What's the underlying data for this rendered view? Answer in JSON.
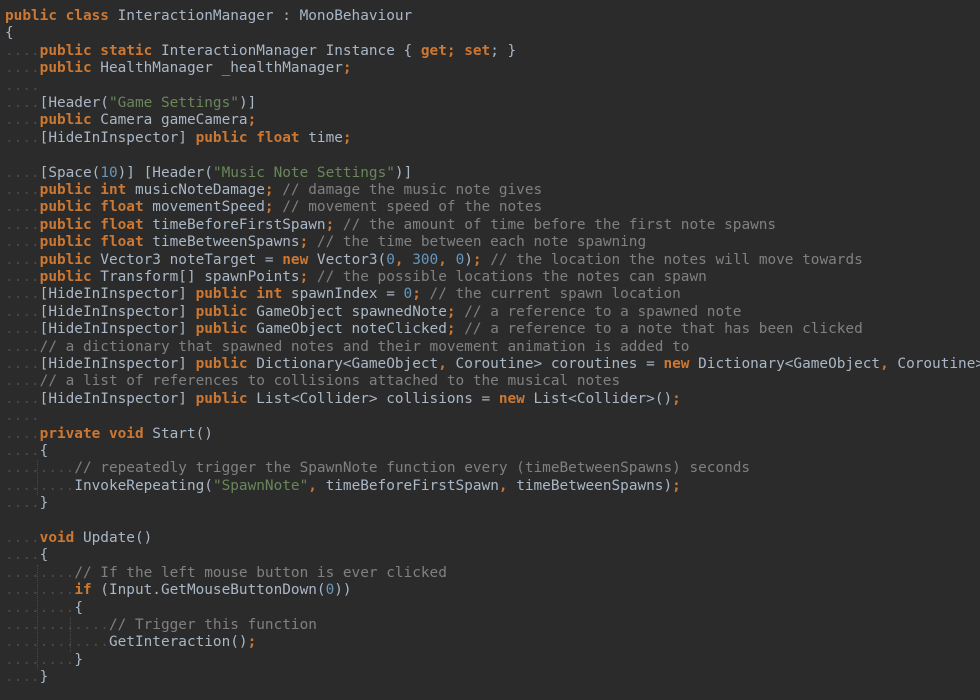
{
  "colors": {
    "background": "#2b2b2b",
    "plain": "#a9b7c6",
    "keyword": "#cc7832",
    "comment": "#808080",
    "string": "#6a8759",
    "number": "#6897bb",
    "indent_dots": "#4a4a4a"
  },
  "editor": {
    "lines": [
      {
        "indent": 0,
        "tokens": [
          {
            "t": "public class",
            "c": "kw"
          },
          {
            "t": " InteractionManager : MonoBehaviour",
            "c": "pl"
          }
        ]
      },
      {
        "indent": 0,
        "tokens": [
          {
            "t": "{",
            "c": "pl"
          }
        ]
      },
      {
        "indent": 4,
        "tokens": [
          {
            "t": "public static",
            "c": "kw"
          },
          {
            "t": " InteractionManager Instance { ",
            "c": "pl"
          },
          {
            "t": "get",
            "c": "kw"
          },
          {
            "t": "; ",
            "c": "kw"
          },
          {
            "t": "set",
            "c": "kw"
          },
          {
            "t": "; }",
            "c": "pl"
          }
        ]
      },
      {
        "indent": 4,
        "tokens": [
          {
            "t": "public",
            "c": "kw"
          },
          {
            "t": " HealthManager _healthManager",
            "c": "pl"
          },
          {
            "t": ";",
            "c": "kw"
          }
        ]
      },
      {
        "indent": 4,
        "tokens": []
      },
      {
        "indent": 4,
        "tokens": [
          {
            "t": "[Header(",
            "c": "pl"
          },
          {
            "t": "\"Game Settings\"",
            "c": "str"
          },
          {
            "t": ")]",
            "c": "pl"
          }
        ]
      },
      {
        "indent": 4,
        "tokens": [
          {
            "t": "public",
            "c": "kw"
          },
          {
            "t": " Camera gameCamera",
            "c": "pl"
          },
          {
            "t": ";",
            "c": "kw"
          }
        ]
      },
      {
        "indent": 4,
        "tokens": [
          {
            "t": "[HideInInspector] ",
            "c": "pl"
          },
          {
            "t": "public float",
            "c": "kw"
          },
          {
            "t": " time",
            "c": "pl"
          },
          {
            "t": ";",
            "c": "kw"
          }
        ]
      },
      {
        "indent": 0,
        "tokens": []
      },
      {
        "indent": 4,
        "tokens": [
          {
            "t": "[Space(",
            "c": "pl"
          },
          {
            "t": "10",
            "c": "num"
          },
          {
            "t": ")] [Header(",
            "c": "pl"
          },
          {
            "t": "\"Music Note Settings\"",
            "c": "str"
          },
          {
            "t": ")]",
            "c": "pl"
          }
        ]
      },
      {
        "indent": 4,
        "tokens": [
          {
            "t": "public int",
            "c": "kw"
          },
          {
            "t": " musicNoteDamage",
            "c": "pl"
          },
          {
            "t": "; ",
            "c": "kw"
          },
          {
            "t": "// damage the music note gives",
            "c": "cm"
          }
        ]
      },
      {
        "indent": 4,
        "tokens": [
          {
            "t": "public float",
            "c": "kw"
          },
          {
            "t": " movementSpeed",
            "c": "pl"
          },
          {
            "t": "; ",
            "c": "kw"
          },
          {
            "t": "// movement speed of the notes",
            "c": "cm"
          }
        ]
      },
      {
        "indent": 4,
        "tokens": [
          {
            "t": "public float",
            "c": "kw"
          },
          {
            "t": " timeBeforeFirstSpawn",
            "c": "pl"
          },
          {
            "t": "; ",
            "c": "kw"
          },
          {
            "t": "// the amount of time before the first note spawns",
            "c": "cm"
          }
        ]
      },
      {
        "indent": 4,
        "tokens": [
          {
            "t": "public float",
            "c": "kw"
          },
          {
            "t": " timeBetweenSpawns",
            "c": "pl"
          },
          {
            "t": "; ",
            "c": "kw"
          },
          {
            "t": "// the time between each note spawning",
            "c": "cm"
          }
        ]
      },
      {
        "indent": 4,
        "tokens": [
          {
            "t": "public",
            "c": "kw"
          },
          {
            "t": " Vector3 noteTarget = ",
            "c": "pl"
          },
          {
            "t": "new",
            "c": "kw"
          },
          {
            "t": " Vector3(",
            "c": "pl"
          },
          {
            "t": "0",
            "c": "num"
          },
          {
            "t": ", ",
            "c": "kw"
          },
          {
            "t": "300",
            "c": "num"
          },
          {
            "t": ", ",
            "c": "kw"
          },
          {
            "t": "0",
            "c": "num"
          },
          {
            "t": ")",
            "c": "pl"
          },
          {
            "t": "; ",
            "c": "kw"
          },
          {
            "t": "// the location the notes will move towards",
            "c": "cm"
          }
        ]
      },
      {
        "indent": 4,
        "tokens": [
          {
            "t": "public",
            "c": "kw"
          },
          {
            "t": " Transform[] spawnPoints",
            "c": "pl"
          },
          {
            "t": "; ",
            "c": "kw"
          },
          {
            "t": "// the possible locations the notes can spawn",
            "c": "cm"
          }
        ]
      },
      {
        "indent": 4,
        "tokens": [
          {
            "t": "[HideInInspector] ",
            "c": "pl"
          },
          {
            "t": "public int",
            "c": "kw"
          },
          {
            "t": " spawnIndex = ",
            "c": "pl"
          },
          {
            "t": "0",
            "c": "num"
          },
          {
            "t": "; ",
            "c": "kw"
          },
          {
            "t": "// the current spawn location",
            "c": "cm"
          }
        ]
      },
      {
        "indent": 4,
        "tokens": [
          {
            "t": "[HideInInspector] ",
            "c": "pl"
          },
          {
            "t": "public",
            "c": "kw"
          },
          {
            "t": " GameObject spawnedNote",
            "c": "pl"
          },
          {
            "t": "; ",
            "c": "kw"
          },
          {
            "t": "// a reference to a spawned note",
            "c": "cm"
          }
        ]
      },
      {
        "indent": 4,
        "tokens": [
          {
            "t": "[HideInInspector] ",
            "c": "pl"
          },
          {
            "t": "public",
            "c": "kw"
          },
          {
            "t": " GameObject noteClicked",
            "c": "pl"
          },
          {
            "t": "; ",
            "c": "kw"
          },
          {
            "t": "// a reference to a note that has been clicked",
            "c": "cm"
          }
        ]
      },
      {
        "indent": 4,
        "tokens": [
          {
            "t": "// a dictionary that spawned notes and their movement animation is added to",
            "c": "cm"
          }
        ]
      },
      {
        "indent": 4,
        "tokens": [
          {
            "t": "[HideInInspector] ",
            "c": "pl"
          },
          {
            "t": "public",
            "c": "kw"
          },
          {
            "t": " Dictionary<GameObject",
            "c": "pl"
          },
          {
            "t": ", ",
            "c": "kw"
          },
          {
            "t": "Coroutine> coroutines = ",
            "c": "pl"
          },
          {
            "t": "new",
            "c": "kw"
          },
          {
            "t": " Dictionary<GameObject",
            "c": "pl"
          },
          {
            "t": ", ",
            "c": "kw"
          },
          {
            "t": "Coroutine>()",
            "c": "pl"
          },
          {
            "t": ";",
            "c": "kw"
          }
        ]
      },
      {
        "indent": 4,
        "tokens": [
          {
            "t": "// a list of references to collisions attached to the musical notes",
            "c": "cm"
          }
        ]
      },
      {
        "indent": 4,
        "tokens": [
          {
            "t": "[HideInInspector] ",
            "c": "pl"
          },
          {
            "t": "public",
            "c": "kw"
          },
          {
            "t": " List<Collider> collisions = ",
            "c": "pl"
          },
          {
            "t": "new",
            "c": "kw"
          },
          {
            "t": " List<Collider>()",
            "c": "pl"
          },
          {
            "t": ";",
            "c": "kw"
          }
        ]
      },
      {
        "indent": 4,
        "tokens": []
      },
      {
        "indent": 4,
        "tokens": [
          {
            "t": "private void",
            "c": "kw"
          },
          {
            "t": " Start()",
            "c": "pl"
          }
        ]
      },
      {
        "indent": 4,
        "tokens": [
          {
            "t": "{",
            "c": "pl"
          }
        ]
      },
      {
        "indent": 8,
        "tokens": [
          {
            "t": "// repeatedly trigger the SpawnNote function every (timeBetweenSpawns) seconds",
            "c": "cm"
          }
        ]
      },
      {
        "indent": 8,
        "tokens": [
          {
            "t": "InvokeRepeating(",
            "c": "pl"
          },
          {
            "t": "\"SpawnNote\"",
            "c": "str"
          },
          {
            "t": ", ",
            "c": "kw"
          },
          {
            "t": "timeBeforeFirstSpawn",
            "c": "pl"
          },
          {
            "t": ", ",
            "c": "kw"
          },
          {
            "t": "timeBetweenSpawns)",
            "c": "pl"
          },
          {
            "t": ";",
            "c": "kw"
          }
        ]
      },
      {
        "indent": 4,
        "tokens": [
          {
            "t": "}",
            "c": "pl"
          }
        ]
      },
      {
        "indent": 0,
        "tokens": []
      },
      {
        "indent": 4,
        "tokens": [
          {
            "t": "void",
            "c": "kw"
          },
          {
            "t": " Update()",
            "c": "pl"
          }
        ]
      },
      {
        "indent": 4,
        "tokens": [
          {
            "t": "{",
            "c": "pl"
          }
        ]
      },
      {
        "indent": 8,
        "tokens": [
          {
            "t": "// If the left mouse button is ever clicked",
            "c": "cm"
          }
        ]
      },
      {
        "indent": 8,
        "tokens": [
          {
            "t": "if",
            "c": "kw"
          },
          {
            "t": " (Input.GetMouseButtonDown(",
            "c": "pl"
          },
          {
            "t": "0",
            "c": "num"
          },
          {
            "t": "))",
            "c": "pl"
          }
        ]
      },
      {
        "indent": 8,
        "tokens": [
          {
            "t": "{",
            "c": "pl"
          }
        ]
      },
      {
        "indent": 12,
        "tokens": [
          {
            "t": "// Trigger this function",
            "c": "cm"
          }
        ]
      },
      {
        "indent": 12,
        "tokens": [
          {
            "t": "GetInteraction()",
            "c": "pl"
          },
          {
            "t": ";",
            "c": "kw"
          }
        ]
      },
      {
        "indent": 8,
        "tokens": [
          {
            "t": "}",
            "c": "pl"
          }
        ]
      },
      {
        "indent": 4,
        "tokens": [
          {
            "t": "}",
            "c": "pl"
          }
        ]
      }
    ]
  }
}
